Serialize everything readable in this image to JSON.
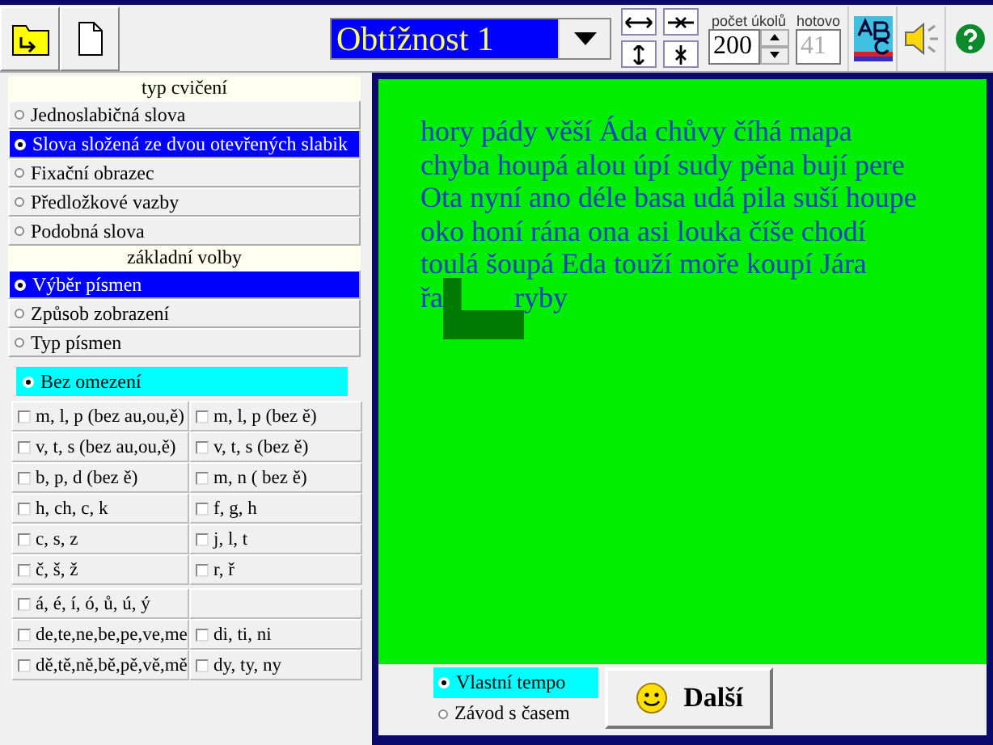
{
  "toolbar": {
    "difficulty": {
      "value": "Obtížnost 1"
    },
    "task_count": {
      "label": "počet úkolů",
      "value": "200"
    },
    "done": {
      "label": "hotovo",
      "value": "41",
      "disabled": true
    }
  },
  "exercise_types": {
    "title": "typ cvičení",
    "items": [
      {
        "label": "Jednoslabičná slova",
        "selected": false
      },
      {
        "label": "Slova složená ze dvou otevřených slabik",
        "selected": true
      },
      {
        "label": "Fixační obrazec",
        "selected": false
      },
      {
        "label": "Předložkové vazby",
        "selected": false
      },
      {
        "label": "Podobná slova",
        "selected": false
      }
    ]
  },
  "basic_options": {
    "title": "základní volby",
    "items": [
      {
        "label": "Výběr písmen",
        "selected": true
      },
      {
        "label": "Způsob zobrazení",
        "selected": false
      },
      {
        "label": "Typ písmen",
        "selected": false
      }
    ]
  },
  "restriction": {
    "label": "Bez omezení",
    "selected": true
  },
  "letter_groups": [
    [
      {
        "label": "m, l, p (bez au,ou,ě)",
        "checked": false
      },
      {
        "label": "m, l, p (bez ě)",
        "checked": false
      }
    ],
    [
      {
        "label": "v, t, s (bez au,ou,ě)",
        "checked": false
      },
      {
        "label": "v, t, s (bez ě)",
        "checked": false
      }
    ],
    [
      {
        "label": "b, p, d (bez ě)",
        "checked": false
      },
      {
        "label": "m, n ( bez ě)",
        "checked": false
      }
    ],
    [
      {
        "label": "h, ch, c, k",
        "checked": false
      },
      {
        "label": "f, g, h",
        "checked": false
      }
    ],
    [
      {
        "label": "c, s, z",
        "checked": false
      },
      {
        "label": "j, l, t",
        "checked": false
      }
    ],
    [
      {
        "label": "č, š, ž",
        "checked": false
      },
      {
        "label": "r, ř",
        "checked": false
      }
    ]
  ],
  "letter_groups_2": [
    [
      {
        "label": "á, é, í, ó, ů, ú, ý",
        "checked": false
      }
    ],
    [
      {
        "label": "de,te,ne,be,pe,ve,me",
        "checked": false
      },
      {
        "label": "di, ti, ni",
        "checked": false
      }
    ],
    [
      {
        "label": "dě,tě,ně,bě,pě,vě,mě",
        "checked": false
      },
      {
        "label": "dy, ty, ny",
        "checked": false
      }
    ]
  ],
  "reading_text": {
    "lines": [
      "hory pády věší Áda chůvy číhá mapa",
      "chyba houpá alou úpí sudy pěna bují pere",
      "Ota nyní ano déle basa udá pila suší houpe",
      "oko honí rána ona asi louka číše chodí",
      "toulá šoupá Eda touží moře koupí Jára"
    ],
    "last_line": {
      "before": "řa",
      "after": "ryby"
    }
  },
  "tempo": [
    {
      "label": "Vlastní tempo",
      "selected": true
    },
    {
      "label": "Závod s časem",
      "selected": false
    }
  ],
  "next_button": {
    "label": "Další"
  }
}
